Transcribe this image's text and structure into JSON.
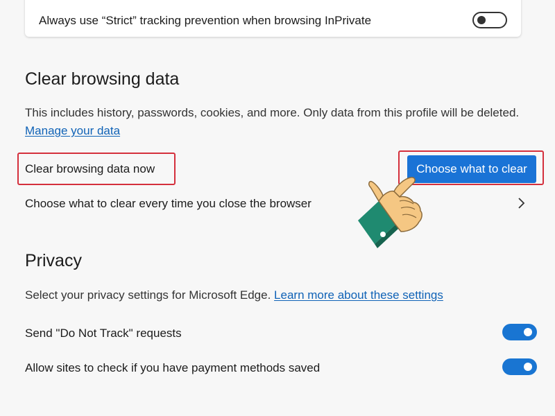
{
  "strict_card": {
    "label": "Always use “Strict” tracking prevention when browsing InPrivate",
    "toggle_state": "off"
  },
  "clear_browsing": {
    "title": "Clear browsing data",
    "description": "This includes history, passwords, cookies, and more. Only data from this profile will be deleted.",
    "manage_link": "Manage your data",
    "now_label": "Clear browsing data now",
    "choose_button": "Choose what to clear",
    "every_time_label": "Choose what to clear every time you close the browser"
  },
  "privacy": {
    "title": "Privacy",
    "description": "Select your privacy settings for Microsoft Edge.",
    "learn_more_link": "Learn more about these settings",
    "settings": [
      {
        "label": "Send \"Do Not Track\" requests",
        "state": "on"
      },
      {
        "label": "Allow sites to check if you have payment methods saved",
        "state": "on"
      }
    ]
  },
  "colors": {
    "accent": "#1a73d6",
    "highlight": "#d42f3c",
    "link": "#0f62b6",
    "background": "#f7f7f7"
  },
  "icons": {
    "chevron": "chevron-right-icon",
    "pointer": "pointing-hand-icon"
  }
}
